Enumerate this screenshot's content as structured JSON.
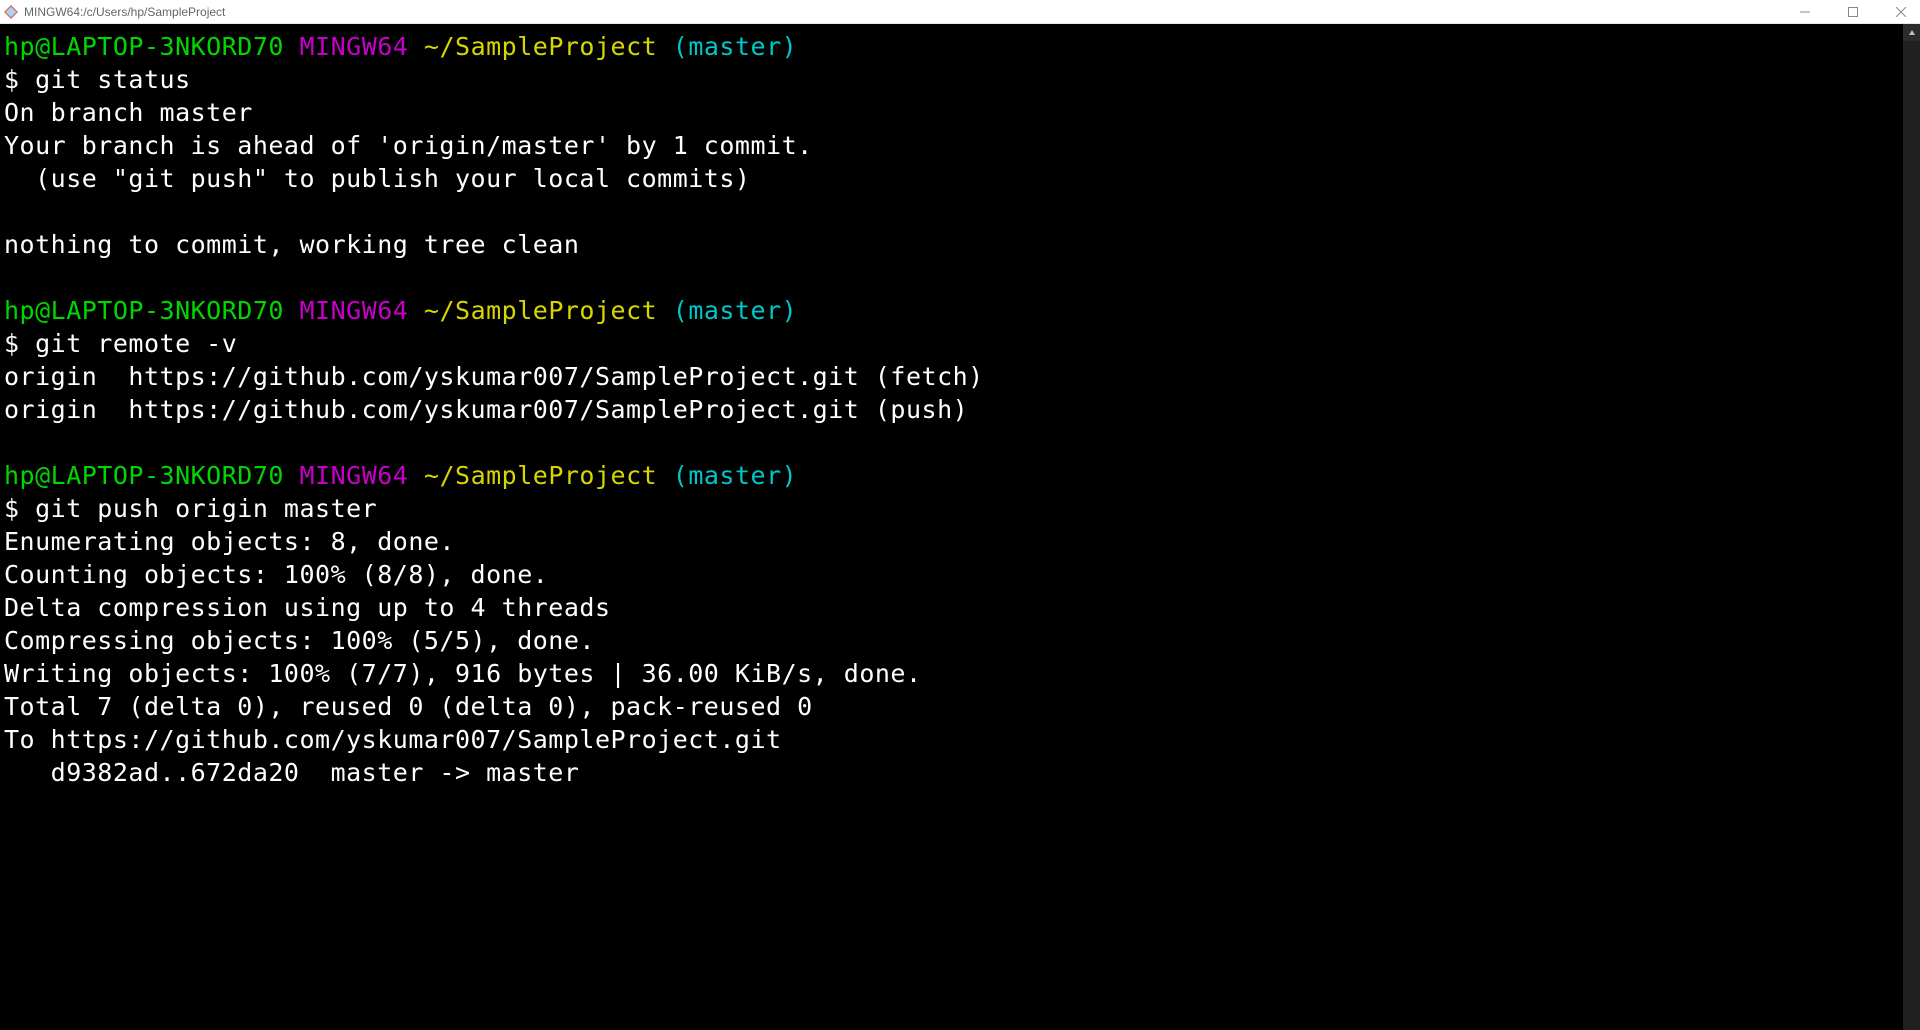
{
  "window": {
    "title": "MINGW64:/c/Users/hp/SampleProject"
  },
  "colors": {
    "user": "#00d700",
    "host": "#c700c7",
    "path": "#d7d700",
    "branch": "#00c7c7"
  },
  "prompt": {
    "user_host": "hp@LAPTOP-3NKORD70",
    "shell": "MINGW64",
    "cwd": "~/SampleProject",
    "branch": "(master)",
    "symbol": "$"
  },
  "blocks": [
    {
      "command": "git status",
      "output": [
        "On branch master",
        "Your branch is ahead of 'origin/master' by 1 commit.",
        "  (use \"git push\" to publish your local commits)",
        "",
        "nothing to commit, working tree clean",
        ""
      ]
    },
    {
      "command": "git remote -v",
      "output": [
        "origin  https://github.com/yskumar007/SampleProject.git (fetch)",
        "origin  https://github.com/yskumar007/SampleProject.git (push)",
        ""
      ]
    },
    {
      "command": "git push origin master",
      "output": [
        "Enumerating objects: 8, done.",
        "Counting objects: 100% (8/8), done.",
        "Delta compression using up to 4 threads",
        "Compressing objects: 100% (5/5), done.",
        "Writing objects: 100% (7/7), 916 bytes | 36.00 KiB/s, done.",
        "Total 7 (delta 0), reused 0 (delta 0), pack-reused 0",
        "To https://github.com/yskumar007/SampleProject.git",
        "   d9382ad..672da20  master -> master"
      ]
    }
  ]
}
